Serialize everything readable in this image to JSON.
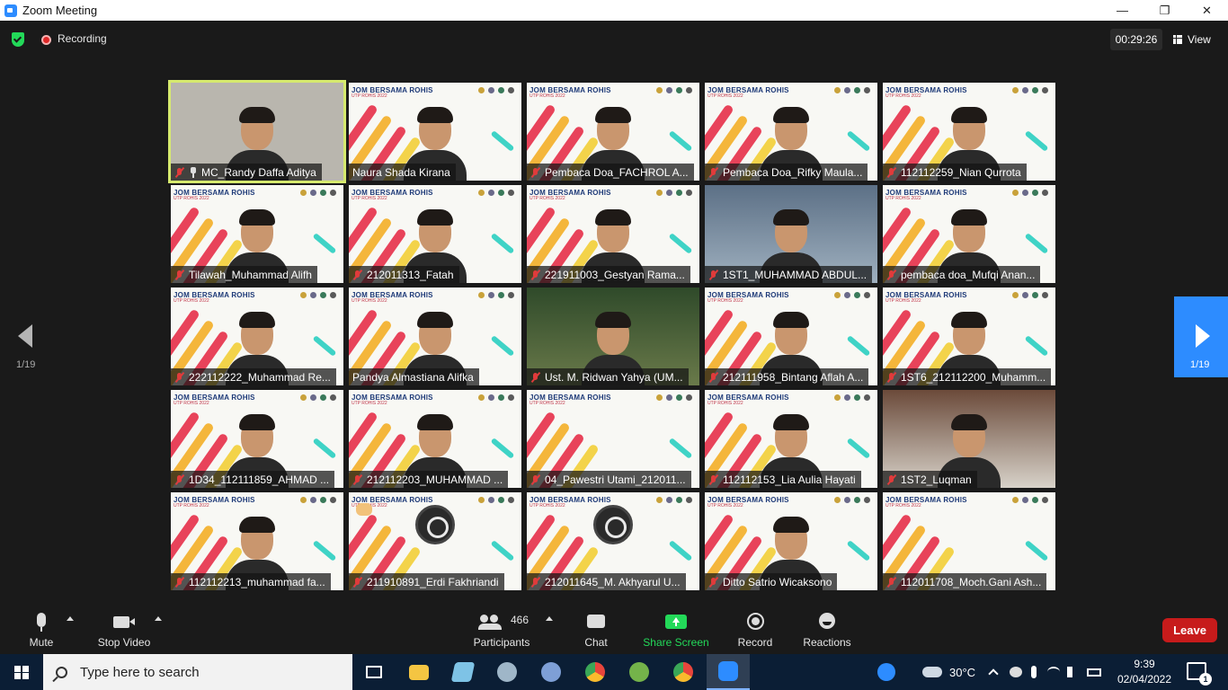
{
  "window": {
    "title": "Zoom Meeting",
    "controls": [
      "—",
      "❐",
      "✕"
    ]
  },
  "topbar": {
    "recording_label": "Recording",
    "timer": "00:29:26",
    "view_label": "View"
  },
  "gallery": {
    "tiles": [
      {
        "name": "MC_Randy Daffa Aditya",
        "active": true,
        "pinned": true,
        "bg": "plain",
        "muted": true
      },
      {
        "name": "Naura Shada Kirana",
        "bg": "event",
        "muted": false
      },
      {
        "name": "Pembaca Doa_FACHROL A...",
        "bg": "event",
        "muted": true
      },
      {
        "name": "Pembaca Doa_Rifky Maula...",
        "bg": "event",
        "muted": true
      },
      {
        "name": "112112259_Nian Qurrota",
        "bg": "event",
        "muted": true
      },
      {
        "name": "Tilawah_Muhammad Alifh",
        "bg": "event",
        "muted": true
      },
      {
        "name": "212011313_Fatah",
        "bg": "event",
        "muted": true
      },
      {
        "name": "221911003_Gestyan Rama...",
        "bg": "event",
        "muted": true
      },
      {
        "name": "1ST1_MUHAMMAD ABDUL...",
        "bg": "room",
        "muted": true
      },
      {
        "name": "pembaca doa_Mufqi Anan...",
        "bg": "event",
        "muted": true
      },
      {
        "name": "222112222_Muhammad Re...",
        "bg": "event",
        "muted": true
      },
      {
        "name": "Pandya Almastiana Alifka",
        "bg": "event",
        "muted": false
      },
      {
        "name": "Ust. M. Ridwan Yahya (UM...",
        "bg": "green-room",
        "muted": true
      },
      {
        "name": "212111958_Bintang Aflah A...",
        "bg": "event",
        "muted": true
      },
      {
        "name": "1ST6_212112200_Muhamm...",
        "bg": "event",
        "muted": true
      },
      {
        "name": "1D34_112111859_AHMAD ...",
        "bg": "event",
        "muted": true
      },
      {
        "name": "212112203_MUHAMMAD ...",
        "bg": "event",
        "muted": true
      },
      {
        "name": "04_Pawestri Utami_212011...",
        "bg": "event",
        "muted": true,
        "empty": true
      },
      {
        "name": "112112153_Lia Aulia Hayati",
        "bg": "event",
        "muted": true
      },
      {
        "name": "1ST2_Luqman",
        "bg": "dark-room",
        "muted": true
      },
      {
        "name": "112112213_muhammad fa...",
        "bg": "event",
        "muted": true
      },
      {
        "name": "211910891_Erdi Fakhriandi",
        "bg": "event",
        "muted": true,
        "obs": true,
        "hand": true
      },
      {
        "name": "212011645_M. Akhyarul U...",
        "bg": "event",
        "muted": true,
        "obs": true
      },
      {
        "name": "Ditto Satrio Wicaksono",
        "bg": "event",
        "muted": true
      },
      {
        "name": "112011708_Moch.Gani Ash...",
        "bg": "event",
        "muted": true,
        "empty": true
      }
    ],
    "event_logo": "JOM BERSAMA ROHIS",
    "event_sub": "UTP ROHIS 2022"
  },
  "pager": {
    "left_label": "1/19",
    "right_label": "1/19"
  },
  "toolbar": {
    "mute_label": "Mute",
    "video_label": "Stop Video",
    "participants_label": "Participants",
    "participants_count": "466",
    "chat_label": "Chat",
    "share_label": "Share Screen",
    "record_label": "Record",
    "reactions_label": "Reactions",
    "leave_label": "Leave"
  },
  "taskbar": {
    "search_placeholder": "Type here to search",
    "weather": "30°C",
    "time": "9:39",
    "date": "02/04/2022",
    "notification_count": "1"
  },
  "colors": {
    "accent": "#2d8cff",
    "share_green": "#23d959",
    "leave_red": "#c71b1b",
    "active_border": "#d6ea6e"
  }
}
